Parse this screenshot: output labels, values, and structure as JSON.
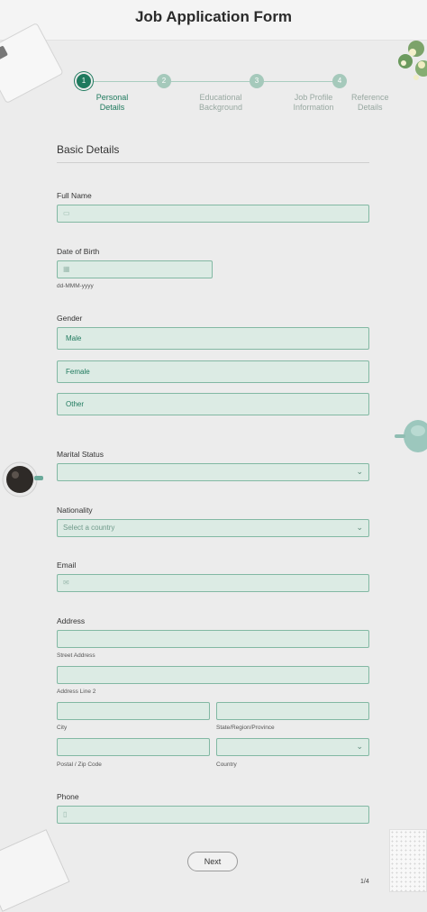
{
  "form": {
    "title": "Job Application Form"
  },
  "steps": [
    {
      "number": "1",
      "label": "Personal Details",
      "active": true
    },
    {
      "number": "2",
      "label": "Educational Background",
      "active": false
    },
    {
      "number": "3",
      "label": "Job Profile Information",
      "active": false
    },
    {
      "number": "4",
      "label": "Reference Details",
      "active": false
    }
  ],
  "section": {
    "title": "Basic Details"
  },
  "fields": {
    "full_name": {
      "label": "Full Name",
      "value": ""
    },
    "dob": {
      "label": "Date of Birth",
      "value": "",
      "hint": "dd-MMM-yyyy"
    },
    "gender": {
      "label": "Gender",
      "options": [
        "Male",
        "Female",
        "Other"
      ]
    },
    "marital": {
      "label": "Marital Status",
      "value": ""
    },
    "nationality": {
      "label": "Nationality",
      "placeholder": "Select a country"
    },
    "email": {
      "label": "Email",
      "value": ""
    },
    "address": {
      "label": "Address",
      "street": "Street Address",
      "line2": "Address Line 2",
      "city": "City",
      "state": "State/Region/Province",
      "zip": "Postal / Zip Code",
      "country": "Country"
    },
    "phone": {
      "label": "Phone",
      "value": ""
    }
  },
  "nav": {
    "next_label": "Next",
    "page_indicator": "1/4"
  },
  "colors": {
    "accent": "#1f7a5e",
    "field_bg": "#dcebe4",
    "field_border": "#82b8a3"
  },
  "icons": [
    "id-card-icon",
    "calendar-icon",
    "envelope-icon",
    "phone-icon",
    "chevron-down-icon"
  ]
}
